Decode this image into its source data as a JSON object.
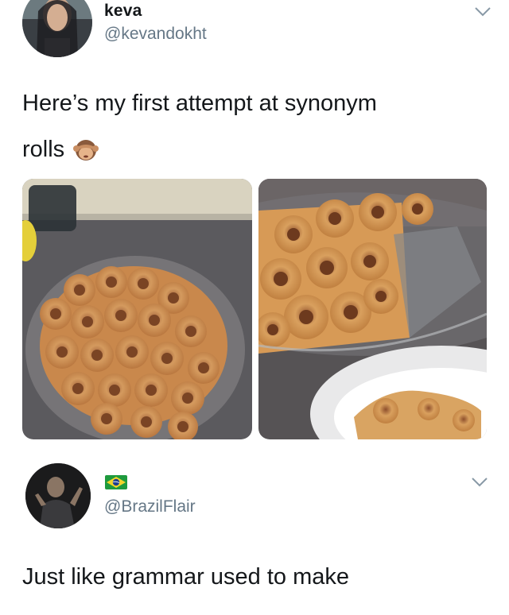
{
  "tweet": {
    "name": "keva",
    "handle": "@kevandokht",
    "text_line1": "Here’s my first attempt at synonym",
    "text_line2": "rolls",
    "emoji": "see-no-evil-monkey",
    "images": [
      "cinnamon-rolls-in-glass-dish",
      "cinnamon-rolls-with-plate"
    ]
  },
  "reply": {
    "flag": "brazil-flag",
    "handle": "@BrazilFlair",
    "text": "Just like grammar used to make"
  },
  "colors": {
    "text": "#14171a",
    "secondary": "#657786",
    "background": "#ffffff"
  }
}
